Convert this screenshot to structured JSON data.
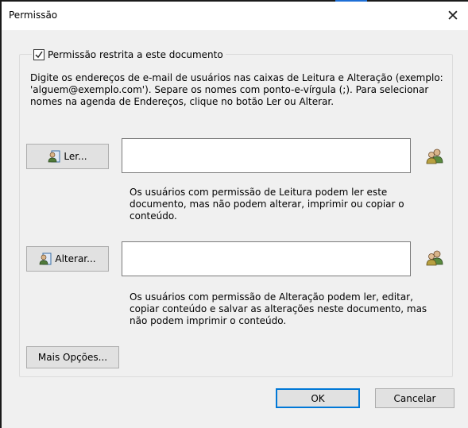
{
  "window": {
    "title": "Permissão"
  },
  "permission": {
    "restrict_label": "Permissão restrita a este documento",
    "restrict_checked": true,
    "description": "Digite os endereços de e-mail de usuários nas caixas de Leitura e Alteração (exemplo: 'alguem@exemplo.com'). Separe os nomes com ponto-e-vírgula (;). Para selecionar nomes na agenda de Endereços, clique no botão Ler ou Alterar."
  },
  "read": {
    "button_label": "Ler...",
    "value": "",
    "note": "Os usuários com permissão de Leitura podem ler este documento, mas não podem alterar, imprimir ou copiar o conteúdo."
  },
  "change": {
    "button_label": "Alterar...",
    "value": "",
    "note": "Os usuários com permissão de Alteração podem ler, editar, copiar conteúdo e salvar as alterações neste documento, mas não podem imprimir o conteúdo."
  },
  "more_options_label": "Mais Opções...",
  "footer": {
    "ok_label": "OK",
    "cancel_label": "Cancelar"
  },
  "icons": {
    "close": "close-icon",
    "address_book": "address-book-icon",
    "users": "users-icon"
  },
  "colors": {
    "accent": "#0078d7",
    "top_highlight": "#1e6fd6"
  }
}
